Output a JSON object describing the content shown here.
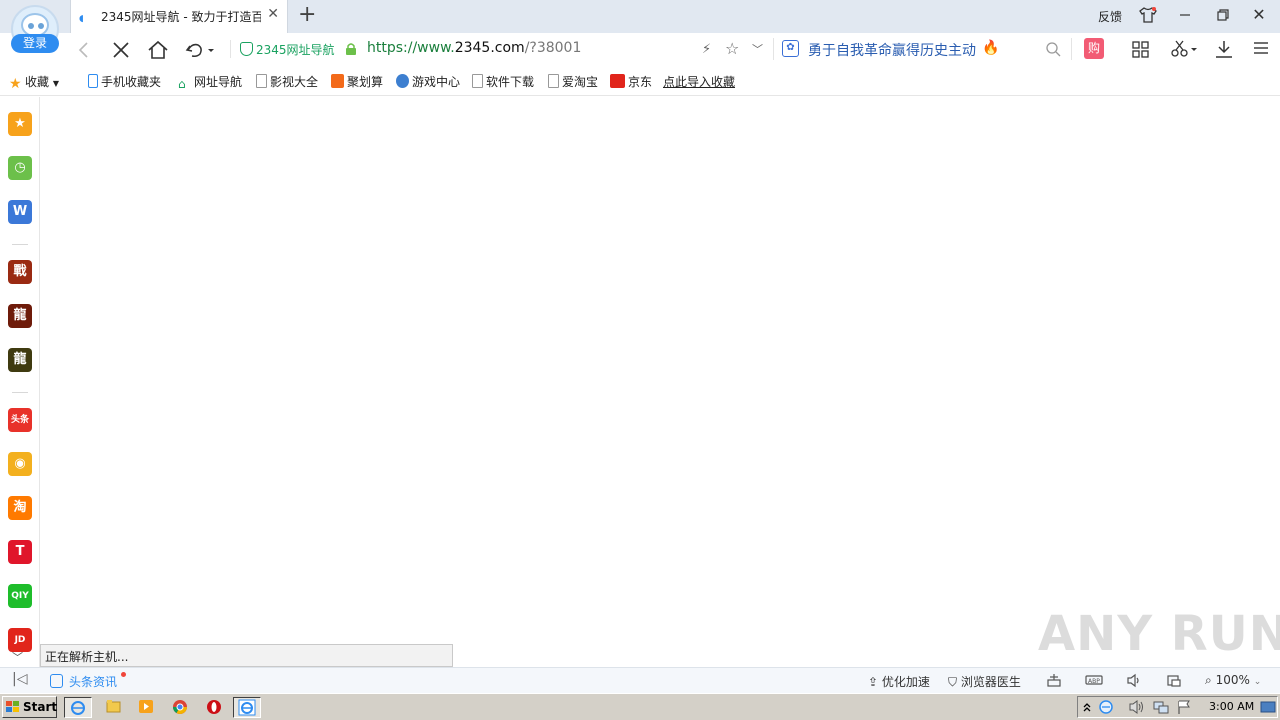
{
  "tabbar": {
    "login_label": "登录",
    "tab_title": "2345网址导航 - 致力于打造百",
    "new_tab_symbol": "+",
    "feedback_label": "反馈"
  },
  "navbar": {
    "site_badge": "2345网址导航",
    "url_scheme": "https://www.",
    "url_domain": "2345.com",
    "url_path": "/?38001",
    "hot_search": "勇于自我革命赢得历史主动",
    "shop_label": "购"
  },
  "bookmarks": {
    "favorites": "收藏",
    "items": [
      "手机收藏夹",
      "网址导航",
      "影视大全",
      "聚划算",
      "游戏中心",
      "软件下载",
      "爱淘宝",
      "京东"
    ],
    "import": "点此导入收藏"
  },
  "sidebar": {
    "icons": [
      {
        "name": "favorites-icon",
        "glyph": "★",
        "color": "#f7a21b"
      },
      {
        "name": "history-icon",
        "glyph": "◷",
        "color": "#6cc04a"
      },
      {
        "name": "word-doc-icon",
        "glyph": "W",
        "color": "#3b78d8"
      },
      {
        "name": "game-icon-1",
        "glyph": "戰",
        "color": "#9a2a12"
      },
      {
        "name": "game-icon-2",
        "glyph": "龍",
        "color": "#6e1b0a"
      },
      {
        "name": "game-icon-3",
        "glyph": "龍",
        "color": "#3f3b10"
      },
      {
        "name": "toutiao-icon",
        "glyph": "头条",
        "color": "#e8322a"
      },
      {
        "name": "weibo-icon",
        "glyph": "◉",
        "color": "#f3b01e"
      },
      {
        "name": "taobao-icon",
        "glyph": "淘",
        "color": "#ff7a00"
      },
      {
        "name": "tmall-icon",
        "glyph": "T",
        "color": "#e0162b"
      },
      {
        "name": "iqiyi-icon",
        "glyph": "QIY",
        "color": "#1ebd2b"
      },
      {
        "name": "jd-icon",
        "glyph": "JD",
        "color": "#e1251b"
      }
    ]
  },
  "page": {
    "loading_status": "正在解析主机...",
    "watermark": "ANY RUN"
  },
  "statusbar": {
    "news_label": "头条资讯",
    "speedup_label": "优化加速",
    "doctor_label": "浏览器医生",
    "zoom_label": "100%"
  },
  "taskbar": {
    "start_label": "Start",
    "clock": "3:00 AM"
  }
}
